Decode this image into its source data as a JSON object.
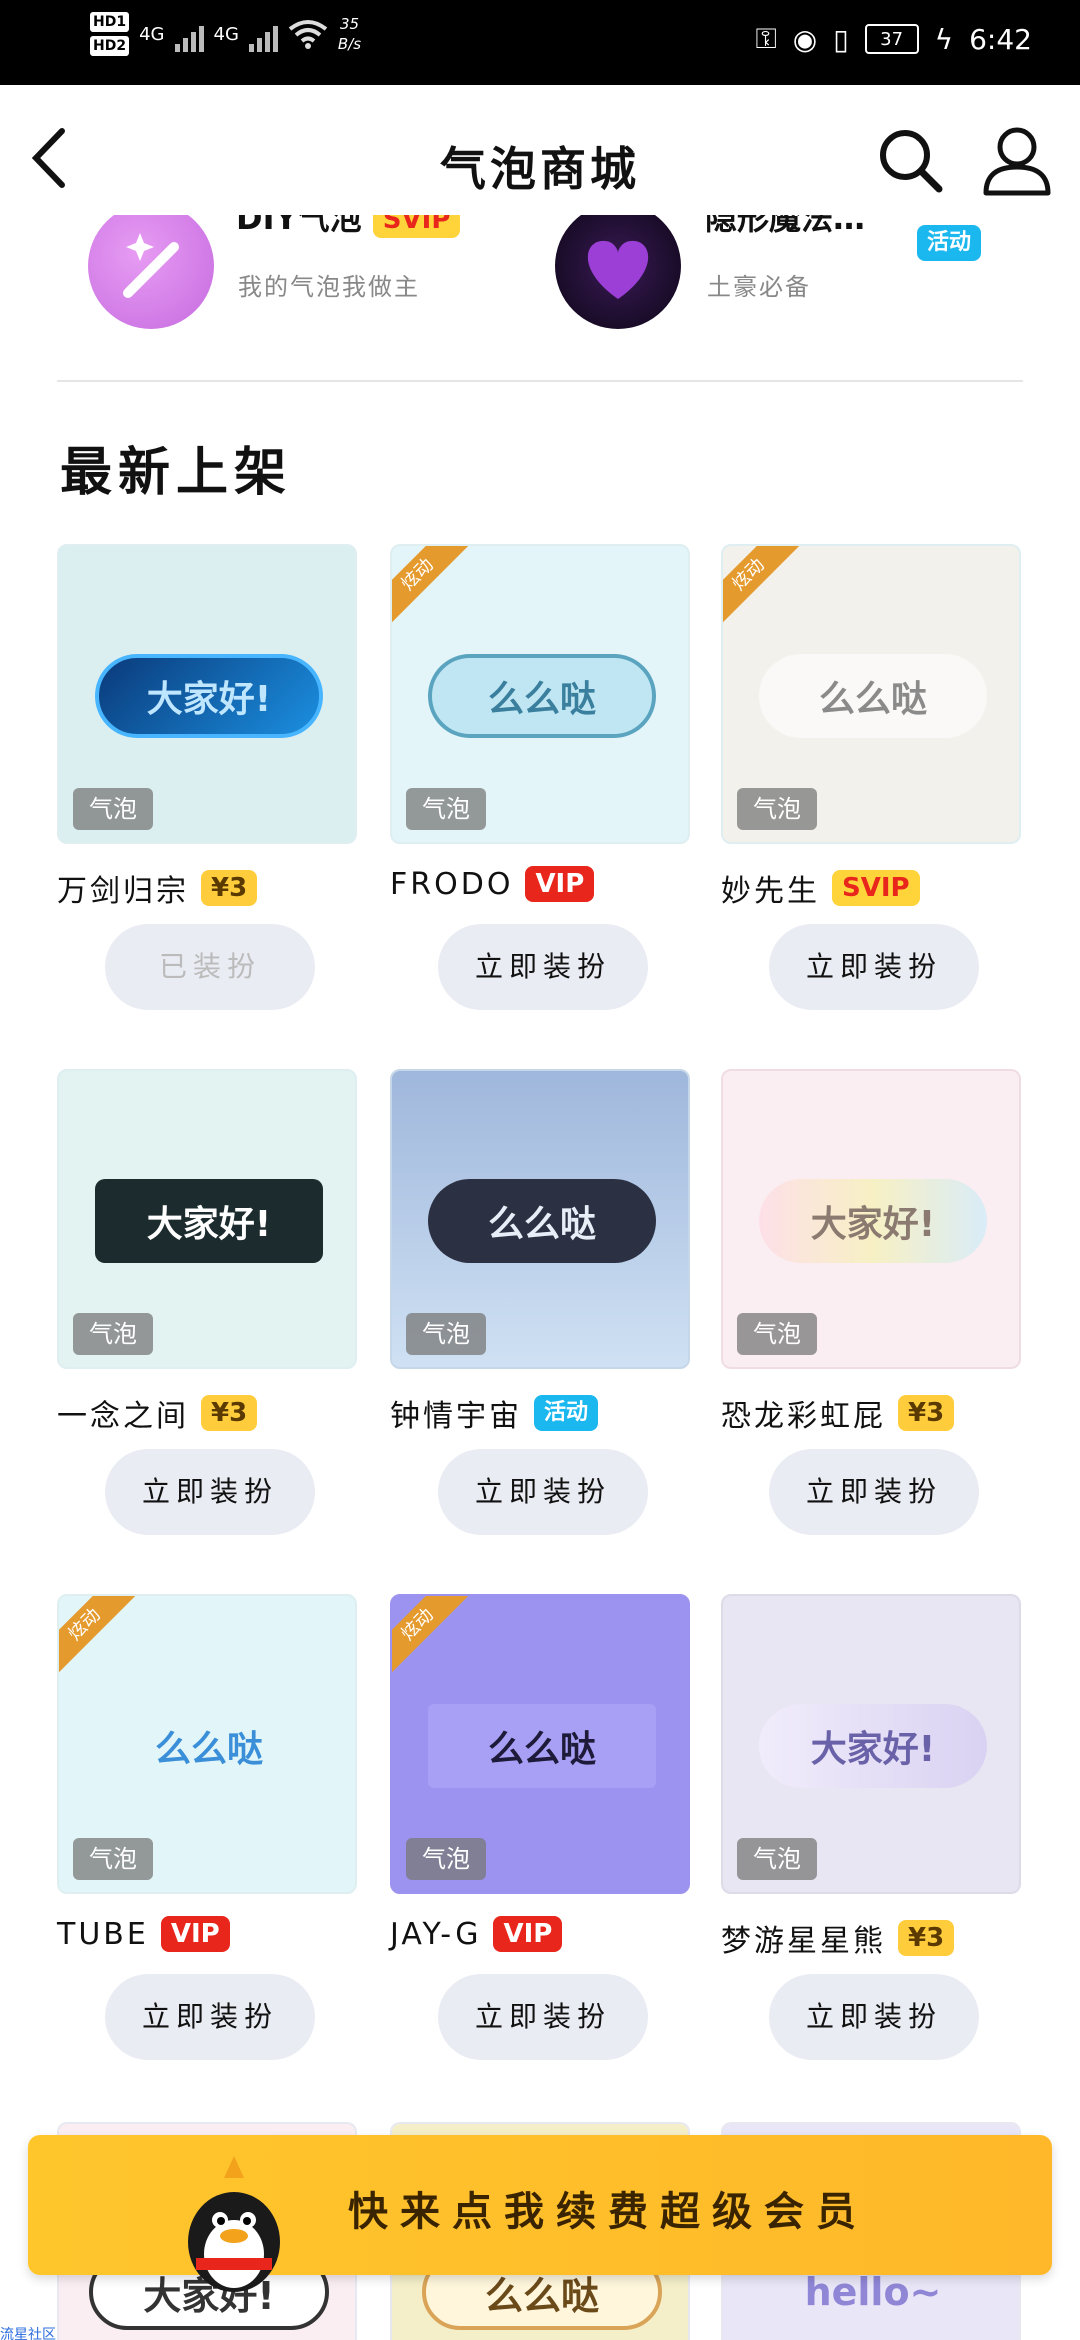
{
  "status_bar": {
    "hd1": "HD1",
    "hd2": "HD2",
    "net1": "4G",
    "net2": "4G",
    "speed": "35",
    "speed_unit": "B/s",
    "battery": "37",
    "time": "6:42"
  },
  "header": {
    "title": "气泡商城",
    "back_icon": "chevron-left-icon",
    "search_icon": "search-icon",
    "user_icon": "user-icon"
  },
  "top_entries": [
    {
      "name": "DIY气泡",
      "tag": "SVIP",
      "subtitle": "我的气泡我做主"
    },
    {
      "name": "隐形魔法…",
      "tag": "活动",
      "subtitle": "土豪必备"
    }
  ],
  "section": {
    "title": "最新上架"
  },
  "items": [
    {
      "name": "万剑归宗",
      "tag": "¥3",
      "tag_type": "price",
      "kind": "气泡",
      "corner": "",
      "preview": "大家好!",
      "action": "已装扮",
      "disabled": true
    },
    {
      "name": "FRODO",
      "tag": "VIP",
      "tag_type": "vip",
      "kind": "气泡",
      "corner": "炫动",
      "preview": "么么哒",
      "action": "立即装扮",
      "disabled": false
    },
    {
      "name": "妙先生",
      "tag": "SVIP",
      "tag_type": "svip",
      "kind": "气泡",
      "corner": "炫动",
      "preview": "么么哒",
      "action": "立即装扮",
      "disabled": false
    },
    {
      "name": "一念之间",
      "tag": "¥3",
      "tag_type": "price",
      "kind": "气泡",
      "corner": "",
      "preview": "大家好!",
      "action": "立即装扮",
      "disabled": false
    },
    {
      "name": "钟情宇宙",
      "tag": "活动",
      "tag_type": "event",
      "kind": "气泡",
      "corner": "",
      "preview": "么么哒",
      "action": "立即装扮",
      "disabled": false
    },
    {
      "name": "恐龙彩虹屁",
      "tag": "¥3",
      "tag_type": "price",
      "kind": "气泡",
      "corner": "",
      "preview": "大家好!",
      "action": "立即装扮",
      "disabled": false
    },
    {
      "name": "TUBE",
      "tag": "VIP",
      "tag_type": "vip",
      "kind": "气泡",
      "corner": "炫动",
      "preview": "么么哒",
      "action": "立即装扮",
      "disabled": false
    },
    {
      "name": "JAY-G",
      "tag": "VIP",
      "tag_type": "vip",
      "kind": "气泡",
      "corner": "炫动",
      "preview": "么么哒",
      "action": "立即装扮",
      "disabled": false
    },
    {
      "name": "梦游星星熊",
      "tag": "¥3",
      "tag_type": "price",
      "kind": "气泡",
      "corner": "",
      "preview": "大家好!",
      "action": "立即装扮",
      "disabled": false
    }
  ],
  "partial_items": [
    {
      "preview": "大家好!"
    },
    {
      "preview": "么么哒"
    },
    {
      "preview": "hello~"
    }
  ],
  "renew_banner": {
    "text": "快来点我续费超级会员"
  },
  "footer": {
    "community": "流星社区"
  },
  "colors": {
    "svip": "#ffd43a",
    "vip": "#e8261b",
    "price": "#ffcd3c",
    "event": "#1bb8ef",
    "banner": "#ffc62c"
  }
}
